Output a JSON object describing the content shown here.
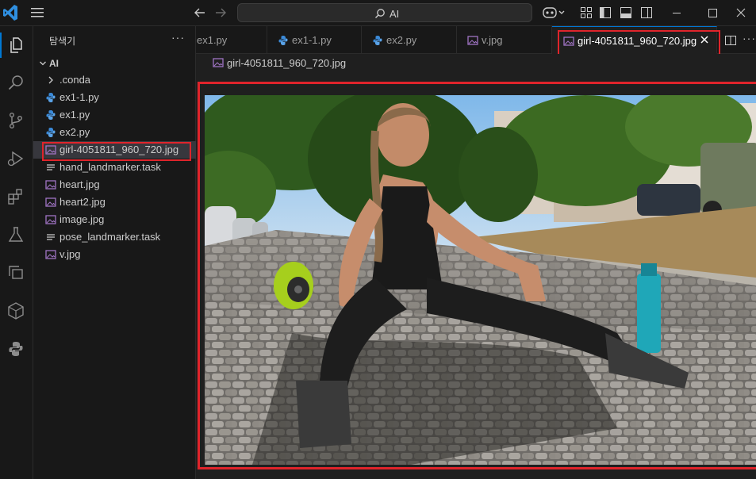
{
  "titlebar": {
    "search_text": "AI",
    "icons": [
      "vscode-logo-icon",
      "hamburger-menu-icon",
      "arrow-left-icon",
      "arrow-right-icon",
      "search-icon",
      "copilot-icon",
      "chevron-down-icon",
      "customize-layout-icon",
      "toggle-sidebar-icon",
      "toggle-panel-icon",
      "toggle-secondary-sidebar-icon",
      "minimize-icon",
      "maximize-icon",
      "close-icon"
    ]
  },
  "activity_bar": {
    "items": [
      "explorer-icon",
      "search-icon",
      "source-control-icon",
      "run-debug-icon",
      "extensions-icon",
      "testing-icon",
      "remote-explorer-icon",
      "containers-icon",
      "python-icon"
    ]
  },
  "sidebar": {
    "title": "탐색기",
    "more": "···",
    "root": "AI",
    "items": [
      {
        "label": ".conda",
        "type": "folder"
      },
      {
        "label": "ex1-1.py",
        "type": "python"
      },
      {
        "label": "ex1.py",
        "type": "python"
      },
      {
        "label": "ex2.py",
        "type": "python"
      },
      {
        "label": "girl-4051811_960_720.jpg",
        "type": "image",
        "selected": true
      },
      {
        "label": "hand_landmarker.task",
        "type": "file"
      },
      {
        "label": "heart.jpg",
        "type": "image"
      },
      {
        "label": "heart2.jpg",
        "type": "image"
      },
      {
        "label": "image.jpg",
        "type": "image"
      },
      {
        "label": "pose_landmarker.task",
        "type": "file"
      },
      {
        "label": "v.jpg",
        "type": "image"
      }
    ]
  },
  "tabs": [
    {
      "label": "ex1.py",
      "type": "python",
      "active": false
    },
    {
      "label": "ex1-1.py",
      "type": "python",
      "active": false
    },
    {
      "label": "ex2.py",
      "type": "python",
      "active": false
    },
    {
      "label": "v.jpg",
      "type": "image",
      "active": false
    },
    {
      "label": "girl-4051811_960_720.jpg",
      "type": "image",
      "active": true
    }
  ],
  "tabs_actions": [
    "split-editor-icon",
    "more-actions-icon"
  ],
  "tabs_more": "···",
  "breadcrumb": {
    "label": "girl-4051811_960_720.jpg"
  },
  "colors": {
    "highlight_red": "#e0242b",
    "accent_blue": "#0078d4",
    "python_blue": "#3b8ad8",
    "image_purple": "#a074c4"
  }
}
